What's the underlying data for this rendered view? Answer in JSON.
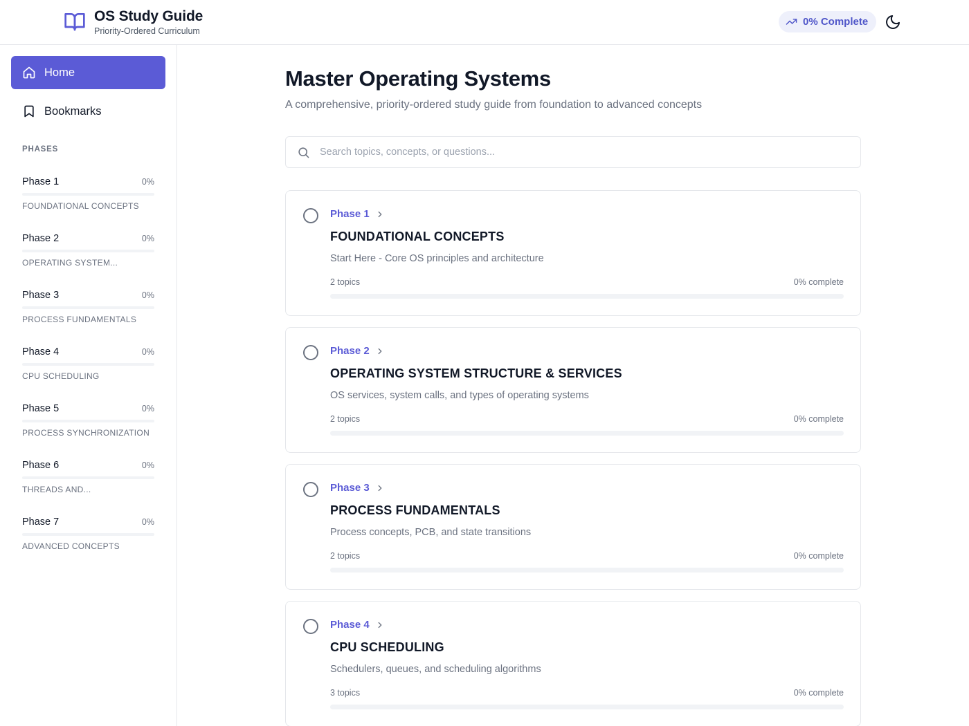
{
  "header": {
    "title": "OS Study Guide",
    "subtitle": "Priority-Ordered Curriculum",
    "progress_label": "0% Complete"
  },
  "sidebar": {
    "home_label": "Home",
    "bookmarks_label": "Bookmarks",
    "phases_heading": "PHASES",
    "phases": [
      {
        "name": "Phase 1",
        "percent": "0%",
        "progress": 0,
        "desc": "FOUNDATIONAL CONCEPTS"
      },
      {
        "name": "Phase 2",
        "percent": "0%",
        "progress": 0,
        "desc": "OPERATING SYSTEM..."
      },
      {
        "name": "Phase 3",
        "percent": "0%",
        "progress": 0,
        "desc": "PROCESS FUNDAMENTALS"
      },
      {
        "name": "Phase 4",
        "percent": "0%",
        "progress": 0,
        "desc": "CPU SCHEDULING"
      },
      {
        "name": "Phase 5",
        "percent": "0%",
        "progress": 0,
        "desc": "PROCESS SYNCHRONIZATION"
      },
      {
        "name": "Phase 6",
        "percent": "0%",
        "progress": 0,
        "desc": "THREADS AND..."
      },
      {
        "name": "Phase 7",
        "percent": "0%",
        "progress": 0,
        "desc": "ADVANCED CONCEPTS"
      }
    ]
  },
  "main": {
    "title": "Master Operating Systems",
    "subtitle": "A comprehensive, priority-ordered study guide from foundation to advanced concepts",
    "search_placeholder": "Search topics, concepts, or questions...",
    "cards": [
      {
        "phase": "Phase 1",
        "title": "FOUNDATIONAL CONCEPTS",
        "desc": "Start Here - Core OS principles and architecture",
        "topics": "2 topics",
        "complete": "0% complete",
        "progress": 0
      },
      {
        "phase": "Phase 2",
        "title": "OPERATING SYSTEM STRUCTURE & SERVICES",
        "desc": "OS services, system calls, and types of operating systems",
        "topics": "2 topics",
        "complete": "0% complete",
        "progress": 0
      },
      {
        "phase": "Phase 3",
        "title": "PROCESS FUNDAMENTALS",
        "desc": "Process concepts, PCB, and state transitions",
        "topics": "2 topics",
        "complete": "0% complete",
        "progress": 0
      },
      {
        "phase": "Phase 4",
        "title": "CPU SCHEDULING",
        "desc": "Schedulers, queues, and scheduling algorithms",
        "topics": "3 topics",
        "complete": "0% complete",
        "progress": 0
      }
    ]
  },
  "colors": {
    "accent": "#5b5bd6",
    "border": "#e5e7eb",
    "muted_text": "#6b7280",
    "track": "#f1f3f6"
  },
  "icons": {
    "brand": "book-open-icon",
    "progress": "trending-up-icon",
    "theme": "moon-icon",
    "home": "home-icon",
    "bookmarks": "bookmark-icon",
    "search": "search-icon",
    "card_status": "circle-icon",
    "card_phase": "chevron-right-icon"
  }
}
